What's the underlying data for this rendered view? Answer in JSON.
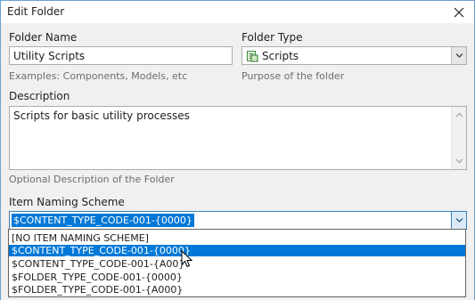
{
  "window": {
    "title": "Edit Folder"
  },
  "folder_name": {
    "label": "Folder Name",
    "value": "Utility Scripts",
    "hint": "Examples: Components, Models, etc"
  },
  "folder_type": {
    "label": "Folder Type",
    "value": "Scripts",
    "hint": "Purpose of the folder"
  },
  "description": {
    "label": "Description",
    "value": "Scripts for basic utility processes",
    "hint": "Optional Description of the Folder"
  },
  "naming_scheme": {
    "label": "Item Naming Scheme",
    "selected": "$CONTENT_TYPE_CODE-001-{0000}",
    "options": [
      "[NO ITEM NAMING SCHEME]",
      "$CONTENT_TYPE_CODE-001-{0000}",
      "$CONTENT_TYPE_CODE-001-{A00}",
      "$FOLDER_TYPE_CODE-001-{0000}",
      "$FOLDER_TYPE_CODE-001-{A000}"
    ],
    "highlighted_index": 1
  },
  "colors": {
    "selection": "#0078d7",
    "window_border": "#6f9fd0",
    "dialog_bg": "#f0f0f0",
    "hint_text": "#6d6d6d"
  }
}
